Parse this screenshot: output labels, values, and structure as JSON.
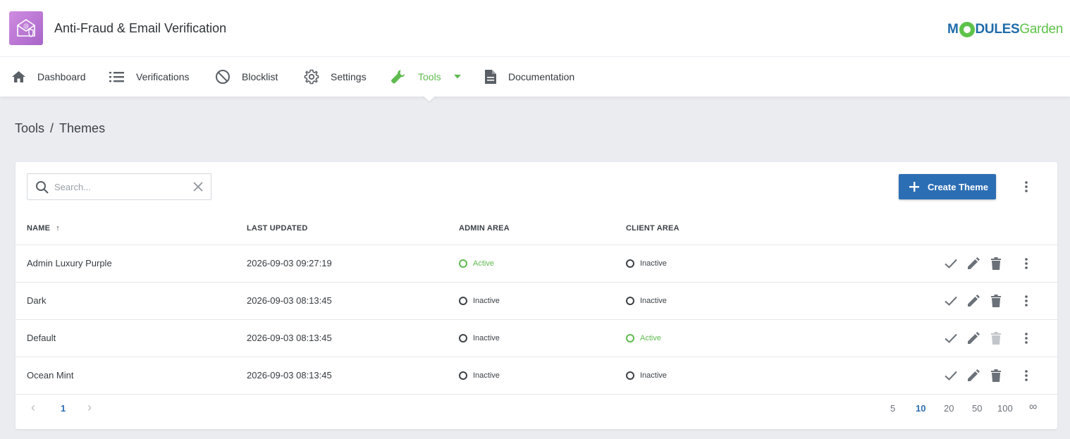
{
  "header": {
    "app_title": "Anti-Fraud & Email Verification",
    "brand_part1": "M",
    "brand_part2": "DULES",
    "brand_part3": "Garden",
    "brand_color_blue": "#1f6baa",
    "brand_color_green": "#5ec24a"
  },
  "nav": {
    "items": [
      {
        "label": "Dashboard",
        "icon": "home-icon"
      },
      {
        "label": "Verifications",
        "icon": "list-icon"
      },
      {
        "label": "Blocklist",
        "icon": "block-icon"
      },
      {
        "label": "Settings",
        "icon": "gear-icon"
      },
      {
        "label": "Tools",
        "icon": "wrench-icon",
        "active": true
      },
      {
        "label": "Documentation",
        "icon": "document-icon"
      }
    ],
    "active_color": "#5fba4f"
  },
  "breadcrumb": {
    "parent": "Tools",
    "separator": "/",
    "current": "Themes"
  },
  "toolbar": {
    "search_placeholder": "Search...",
    "create_label": "Create Theme",
    "accent": "#2c6eb4"
  },
  "table": {
    "columns": [
      "NAME",
      "LAST UPDATED",
      "ADMIN AREA",
      "CLIENT AREA"
    ],
    "sort_arrow": "↑",
    "rows": [
      {
        "name": "Admin Luxury Purple",
        "updated": "2026-09-03 09:27:19",
        "admin": "Active",
        "client": "Inactive"
      },
      {
        "name": "Dark",
        "updated": "2026-09-03 08:13:45",
        "admin": "Inactive",
        "client": "Inactive"
      },
      {
        "name": "Default",
        "updated": "2026-09-03 08:13:45",
        "admin": "Inactive",
        "client": "Active"
      },
      {
        "name": "Ocean Mint",
        "updated": "2026-09-03 08:13:45",
        "admin": "Inactive",
        "client": "Inactive"
      }
    ]
  },
  "pagination": {
    "prev": "‹",
    "current_page": "1",
    "next": "›",
    "page_sizes": [
      "5",
      "10",
      "20",
      "50",
      "100",
      "∞"
    ],
    "selected_size": "10"
  }
}
